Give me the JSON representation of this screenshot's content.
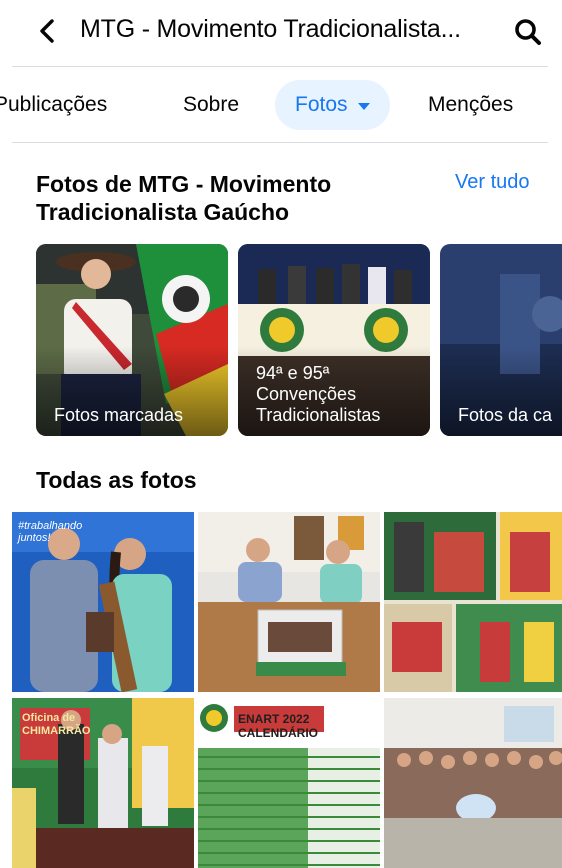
{
  "header": {
    "title": "MTG - Movimento Tradicionalista...",
    "back_icon": "chevron-left-icon",
    "search_icon": "search-icon"
  },
  "tabs": [
    {
      "label": "Publicações",
      "active": false
    },
    {
      "label": "Sobre",
      "active": false
    },
    {
      "label": "Fotos",
      "active": true
    },
    {
      "label": "Menções",
      "active": false
    }
  ],
  "albums_section": {
    "title": "Fotos de MTG - Movimento Tradicionalista Gaúcho",
    "see_all": "Ver tudo",
    "albums": [
      {
        "label": "Fotos marcadas"
      },
      {
        "label": "94ª e 95ª\nConvenções\nTradicionalistas"
      },
      {
        "label": "Fotos da ca"
      }
    ]
  },
  "all_photos": {
    "title": "Todas as fotos",
    "photos": [
      {
        "text": "#trabalhando juntos!"
      },
      {
        "text": ""
      },
      {
        "text": ""
      },
      {
        "text": "Oficina de CHIMARRÃO"
      },
      {
        "text": "ENART 2022 CALENDÁRIO"
      },
      {
        "text": ""
      }
    ]
  },
  "colors": {
    "accent": "#1877f2",
    "active_tab_bg": "#e7f3ff",
    "divider": "#dadde1"
  }
}
